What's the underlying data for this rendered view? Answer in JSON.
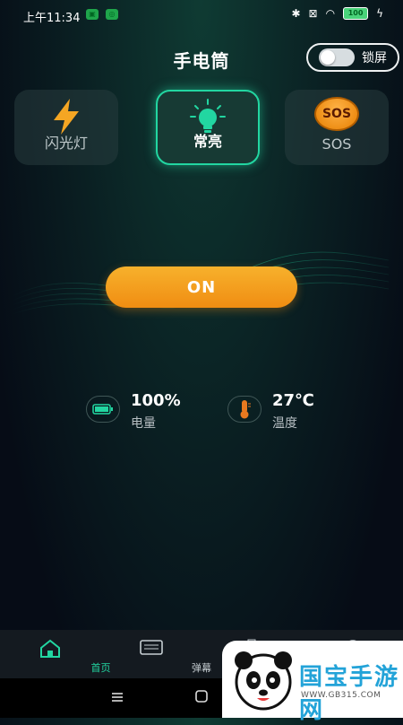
{
  "status_bar": {
    "time": "上午11:34",
    "battery": "100"
  },
  "header": {
    "title": "手电筒",
    "lock_label": "锁屏"
  },
  "modes": [
    {
      "label": "闪光灯",
      "icon": "lightning-icon",
      "active": false
    },
    {
      "label": "常亮",
      "icon": "bulb-icon",
      "active": true
    },
    {
      "label": "SOS",
      "icon": "sos-icon",
      "active": false
    }
  ],
  "sos_badge_text": "SOS",
  "main_button": {
    "label": "ON"
  },
  "stats": [
    {
      "value": "100%",
      "label": "电量",
      "icon": "battery-icon"
    },
    {
      "value": "27℃",
      "label": "温度",
      "icon": "thermometer-icon"
    }
  ],
  "nav": [
    {
      "label": "首页",
      "icon": "home-icon",
      "active": true
    },
    {
      "label": "弹幕",
      "icon": "keyboard-icon",
      "active": false
    }
  ],
  "watermark": {
    "text": "国宝手游网",
    "url": "WWW.GB315.COM"
  },
  "colors": {
    "accent": "#22d6a1",
    "button": "#f39b1a",
    "bg": "#060c16"
  }
}
